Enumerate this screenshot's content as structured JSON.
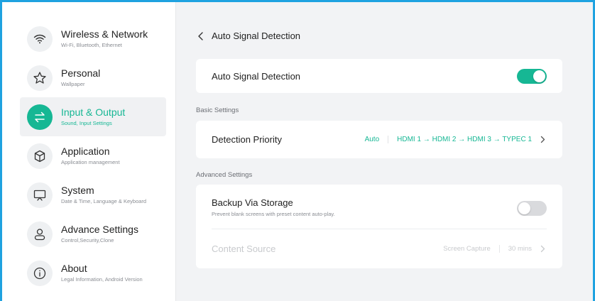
{
  "sidebar": {
    "items": [
      {
        "title": "Wireless & Network",
        "subtitle": "Wi-Fi, Bluetooth, Ethernet",
        "icon": "wifi-icon"
      },
      {
        "title": "Personal",
        "subtitle": "Wallpaper",
        "icon": "star-icon"
      },
      {
        "title": "Input & Output",
        "subtitle": "Sound, Input Settings",
        "icon": "swap-icon"
      },
      {
        "title": "Application",
        "subtitle": "Application management",
        "icon": "cube-icon"
      },
      {
        "title": "System",
        "subtitle": "Date & Time, Language & Keyboard",
        "icon": "monitor-icon"
      },
      {
        "title": "Advance Settings",
        "subtitle": "Control,Security,Clone",
        "icon": "user-icon"
      },
      {
        "title": "About",
        "subtitle": "Legal Information, Android Version",
        "icon": "info-icon"
      }
    ],
    "active_index": 2
  },
  "header": {
    "title": "Auto Signal Detection"
  },
  "auto_signal": {
    "label": "Auto Signal Detection",
    "enabled": true
  },
  "basic": {
    "section_label": "Basic Settings",
    "detection_priority": {
      "label": "Detection Priority",
      "mode": "Auto",
      "order": "HDMI 1 → HDMI 2 → HDMI 3 → TYPEC 1"
    }
  },
  "advanced": {
    "section_label": "Advanced Settings",
    "backup": {
      "label": "Backup Via Storage",
      "description": "Prevent blank screens with preset content auto-play.",
      "enabled": false
    },
    "content_source": {
      "label": "Content Source",
      "source": "Screen Capture",
      "duration": "30 mins"
    }
  },
  "colors": {
    "accent": "#16b794",
    "frame": "#1fa2e0"
  }
}
